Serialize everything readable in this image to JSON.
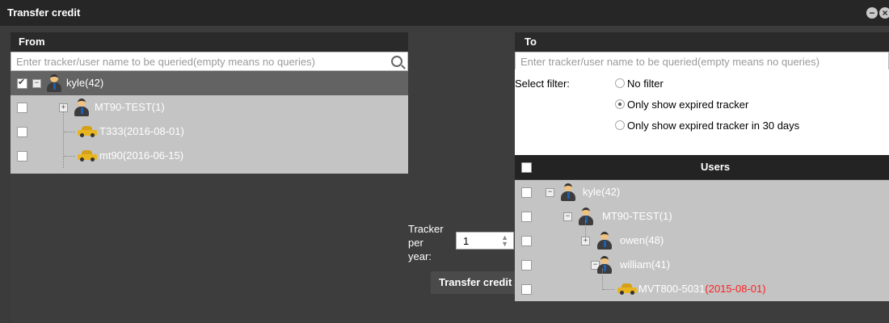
{
  "dialog": {
    "title": "Transfer credit",
    "minimize_icon": "minus-circle-icon",
    "close_icon": "close-circle-icon"
  },
  "from": {
    "header": "From",
    "search_placeholder": "Enter tracker/user name to be queried(empty means no queries)",
    "tree": [
      {
        "label": "kyle(42)",
        "type": "user",
        "checked": true,
        "selected": true
      },
      {
        "label": "MT90-TEST(1)",
        "type": "user",
        "checked": false
      },
      {
        "label": "T333(2016-08-01)",
        "type": "tracker",
        "checked": false
      },
      {
        "label": "mt90(2016-06-15)",
        "type": "tracker",
        "checked": false
      }
    ]
  },
  "middle": {
    "tracker_label_line1": "Tracker",
    "tracker_label_line2": "per",
    "tracker_label_line3": "year:",
    "tracker_value": "1",
    "transfer_button": "Transfer credit"
  },
  "to": {
    "header": "To",
    "search_placeholder": "Enter tracker/user name to be queried(empty means no queries)",
    "filter_label": "Select filter:",
    "filters": [
      {
        "label": "No filter",
        "selected": false
      },
      {
        "label": "Only show expired tracker",
        "selected": true
      },
      {
        "label": "Only show expired tracker in 30 days",
        "selected": false
      }
    ],
    "users_header": "Users",
    "tree": [
      {
        "label": "kyle(42)",
        "type": "user"
      },
      {
        "label": "MT90-TEST(1)",
        "type": "user"
      },
      {
        "label": "owen(48)",
        "type": "user"
      },
      {
        "label": "william(41)",
        "type": "user"
      },
      {
        "label": "MVT800-5031",
        "date": "(2015-08-01)",
        "type": "tracker"
      }
    ]
  },
  "colors": {
    "expired_date": "#ff2020",
    "header_bg": "#262626",
    "tree_bg": "#c4c4c4"
  }
}
